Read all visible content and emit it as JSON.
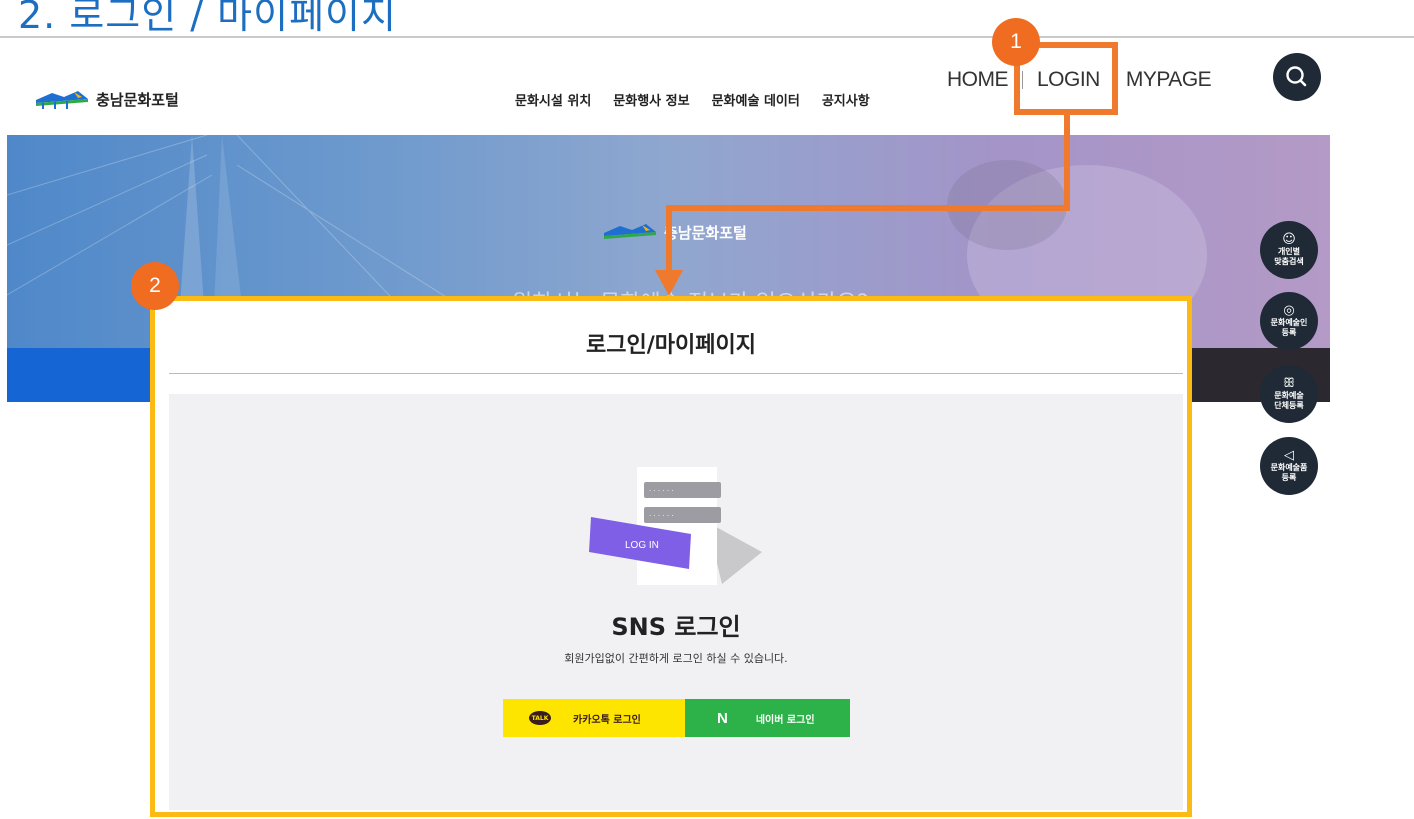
{
  "slide": {
    "title": "2. 로그인 / 마이페이지"
  },
  "header": {
    "logo_text": "충남문화포털",
    "nav": [
      "문화시설 위치",
      "문화행사 정보",
      "문화예술 데이터",
      "공지사항"
    ],
    "util": {
      "home": "HOME",
      "login": "LOGIN",
      "mypage": "MYPAGE"
    },
    "search_icon": "search-icon"
  },
  "hero": {
    "logo_text": "충남문화포털",
    "subtitle": "원하시는 문화예술 정보가 있으신가요?"
  },
  "quick_menu": [
    {
      "icon": "smile-heart-icon",
      "label": "개인별\n맞춤검색"
    },
    {
      "icon": "palette-icon",
      "label": "문화예술인\n등록"
    },
    {
      "icon": "group-icon",
      "label": "문화예술\n단체등록"
    },
    {
      "icon": "megaphone-icon",
      "label": "문화예술품\n등록"
    }
  ],
  "callouts": {
    "first": "1",
    "second": "2"
  },
  "modal": {
    "title": "로그인/마이페이지",
    "illustration_text": "LOG IN",
    "sns_title": "SNS 로그인",
    "sns_desc": "회원가입없이 간편하게 로그인 하실 수 있습니다.",
    "kakao_icon_text": "TALK",
    "kakao_label": "카카오톡 로그인",
    "naver_icon_text": "N",
    "naver_label": "네이버 로그인"
  },
  "colors": {
    "accent_orange": "#ef7a2d",
    "highlight_yellow": "#fbbb14",
    "kakao": "#fee500",
    "naver": "#2db24a",
    "dark": "#1f2a36"
  }
}
